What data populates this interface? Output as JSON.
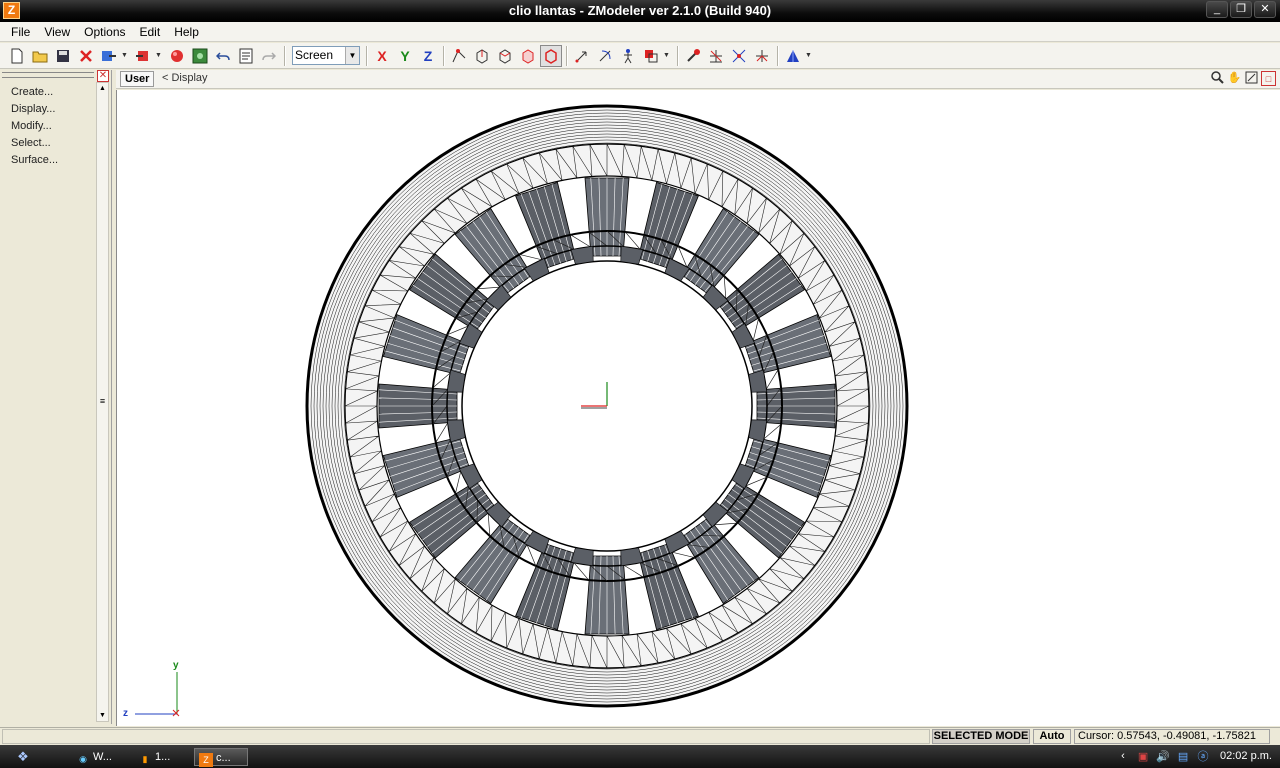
{
  "window": {
    "icon_letter": "Z",
    "title": "clio llantas - ZModeler ver 2.1.0 (Build 940)",
    "buttons": [
      "_",
      "❐",
      "✕"
    ]
  },
  "menu": [
    "File",
    "View",
    "Options",
    "Edit",
    "Help"
  ],
  "toolbar": {
    "view_select": "Screen",
    "axis_x": "X",
    "axis_y": "Y",
    "axis_z": "Z"
  },
  "left_panel": {
    "items": [
      "Create...",
      "Display...",
      "Modify...",
      "Select...",
      "Surface..."
    ]
  },
  "viewport": {
    "label": "User",
    "breadcrumb": "< Display",
    "axis_y": "y",
    "axis_z": "z"
  },
  "status": {
    "mode": "SELECTED MODE",
    "auto": "Auto",
    "cursor": "Cursor: 0.57543, -0.49081, -1.75821"
  },
  "taskbar": {
    "items": [
      {
        "icon": "ie",
        "label": "W..."
      },
      {
        "icon": "app",
        "label": "1..."
      },
      {
        "icon": "zmodeler",
        "label": "c..."
      }
    ],
    "clock": "02:02 p.m."
  }
}
